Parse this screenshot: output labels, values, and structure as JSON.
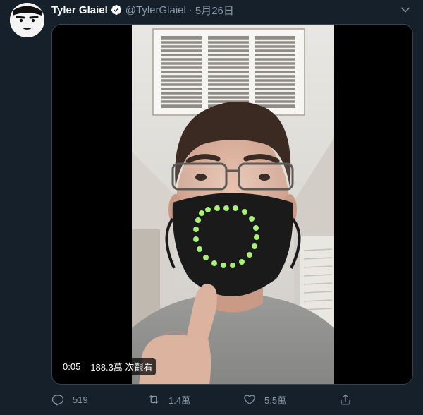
{
  "tweet": {
    "author_name": "Tyler Glaiel",
    "handle": "@TylerGlaiel",
    "separator": "·",
    "date": "5月26日"
  },
  "video": {
    "time": "0:05",
    "views": "188.3萬 次觀看"
  },
  "actions": {
    "reply_count": "519",
    "retweet_count": "1.4萬",
    "like_count": "5.5萬"
  },
  "colors": {
    "background": "#15202b",
    "secondary_text": "#8899a6",
    "verified_badge": "#ffffff",
    "led_green": "#a8f07a"
  },
  "icons": {
    "verified": "verified-badge-icon",
    "caret": "chevron-down-icon",
    "reply": "reply-icon",
    "retweet": "retweet-icon",
    "like": "heart-icon",
    "share": "share-icon"
  }
}
